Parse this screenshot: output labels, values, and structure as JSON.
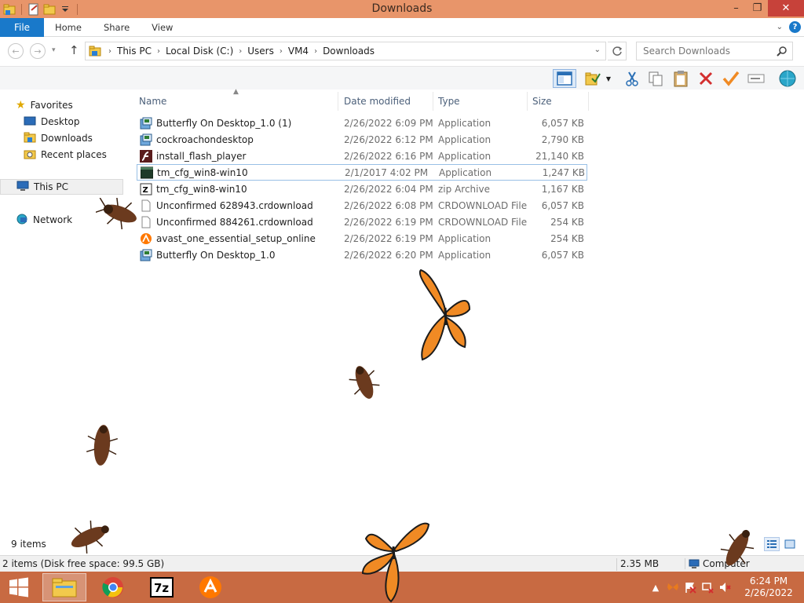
{
  "window": {
    "title": "Downloads"
  },
  "ribbon": {
    "file_tab": "File",
    "tabs": [
      "Home",
      "Share",
      "View"
    ]
  },
  "address": {
    "crumbs": [
      "This PC",
      "Local Disk (C:)",
      "Users",
      "VM4",
      "Downloads"
    ],
    "search_placeholder": "Search Downloads"
  },
  "nav": {
    "favorites": "Favorites",
    "desktop": "Desktop",
    "downloads": "Downloads",
    "recent": "Recent places",
    "thispc": "This PC",
    "network": "Network"
  },
  "columns": {
    "name": "Name",
    "date": "Date modified",
    "type": "Type",
    "size": "Size"
  },
  "files": [
    {
      "name": "Butterfly On Desktop_1.0 (1)",
      "date": "2/26/2022 6:09 PM",
      "type": "Application",
      "size": "6,057 KB",
      "icon": "installer-icon"
    },
    {
      "name": "cockroachondesktop",
      "date": "2/26/2022 6:12 PM",
      "type": "Application",
      "size": "2,790 KB",
      "icon": "installer-icon"
    },
    {
      "name": "install_flash_player",
      "date": "2/26/2022 6:16 PM",
      "type": "Application",
      "size": "21,140 KB",
      "icon": "flash-icon"
    },
    {
      "name": "tm_cfg_win8-win10",
      "date": "2/1/2017 4:02 PM",
      "type": "Application",
      "size": "1,247 KB",
      "icon": "app-window-icon"
    },
    {
      "name": "tm_cfg_win8-win10",
      "date": "2/26/2022 6:04 PM",
      "type": "zip Archive",
      "size": "1,167 KB",
      "icon": "zip-icon"
    },
    {
      "name": "Unconfirmed 628943.crdownload",
      "date": "2/26/2022 6:08 PM",
      "type": "CRDOWNLOAD File",
      "size": "6,057 KB",
      "icon": "blank-file-icon"
    },
    {
      "name": "Unconfirmed 884261.crdownload",
      "date": "2/26/2022 6:19 PM",
      "type": "CRDOWNLOAD File",
      "size": "254 KB",
      "icon": "blank-file-icon"
    },
    {
      "name": "avast_one_essential_setup_online",
      "date": "2/26/2022 6:19 PM",
      "type": "Application",
      "size": "254 KB",
      "icon": "avast-icon"
    },
    {
      "name": "Butterfly On Desktop_1.0",
      "date": "2/26/2022 6:20 PM",
      "type": "Application",
      "size": "6,057 KB",
      "icon": "installer-icon"
    }
  ],
  "status": {
    "items_count": "9 items",
    "selection": "2 items (Disk free space: 99.5 GB)",
    "size": "2.35 MB",
    "location": "Computer"
  },
  "clock": {
    "time": "6:24 PM",
    "date": "2/26/2022"
  },
  "colors": {
    "titlebar": "#e8956a",
    "file_tab": "#1979ca",
    "taskbar": "#c86a42",
    "close": "#c7423a"
  }
}
